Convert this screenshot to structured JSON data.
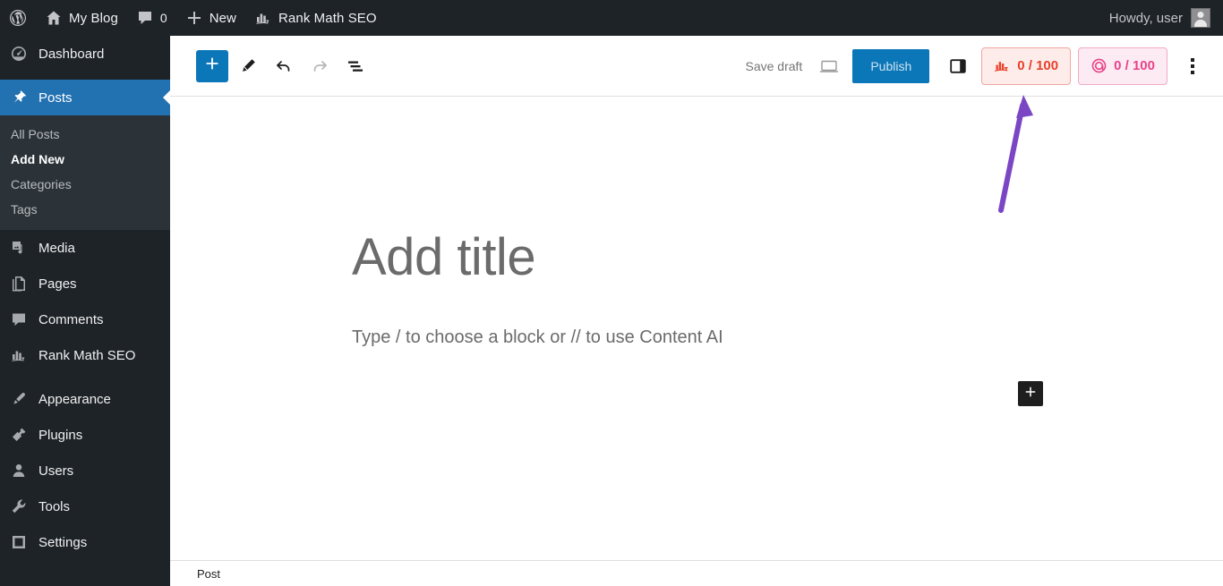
{
  "adminbar": {
    "logo_icon": "wordpress-icon",
    "site": {
      "icon": "home-icon",
      "label": "My Blog"
    },
    "comments": {
      "icon": "comment-icon",
      "count": "0"
    },
    "new": {
      "icon": "plus-icon",
      "label": "New"
    },
    "rankmath": {
      "icon": "rank-math-icon",
      "label": "Rank Math SEO"
    },
    "howdy": "Howdy, user",
    "avatar_icon": "avatar-icon"
  },
  "sidebar": {
    "items": [
      {
        "label": "Dashboard",
        "icon": "dashboard-icon",
        "active": false
      },
      {
        "label": "Posts",
        "icon": "pin-icon",
        "active": true
      },
      {
        "label": "Media",
        "icon": "media-icon",
        "active": false
      },
      {
        "label": "Pages",
        "icon": "pages-icon",
        "active": false
      },
      {
        "label": "Comments",
        "icon": "comment-icon",
        "active": false
      },
      {
        "label": "Rank Math SEO",
        "icon": "rank-math-icon",
        "active": false
      },
      {
        "label": "Appearance",
        "icon": "brush-icon",
        "active": false
      },
      {
        "label": "Plugins",
        "icon": "plug-icon",
        "active": false
      },
      {
        "label": "Users",
        "icon": "user-icon",
        "active": false
      },
      {
        "label": "Tools",
        "icon": "wrench-icon",
        "active": false
      },
      {
        "label": "Settings",
        "icon": "settings-icon",
        "active": false
      }
    ],
    "submenu": [
      {
        "label": "All Posts",
        "current": false
      },
      {
        "label": "Add New",
        "current": true
      },
      {
        "label": "Categories",
        "current": false
      },
      {
        "label": "Tags",
        "current": false
      }
    ]
  },
  "toolbar": {
    "add_block_icon": "plus-icon",
    "tools_icon": "pencil-icon",
    "undo_icon": "undo-icon",
    "redo_icon": "redo-icon",
    "outline_icon": "document-outline-icon",
    "save_draft_label": "Save draft",
    "preview_icon": "preview-laptop-icon",
    "publish_label": "Publish",
    "settings_sidebar_icon": "sidebar-toggle-icon",
    "options_icon": "kebab-menu-icon",
    "seo_score": {
      "icon": "rank-math-icon",
      "value": "0 / 100"
    },
    "content_ai_score": {
      "icon": "content-ai-icon",
      "value": "0 / 100"
    }
  },
  "canvas": {
    "title_placeholder": "Add title",
    "block_prompt": "Type / to choose a block or // to use Content AI",
    "inserter_icon": "plus-icon"
  },
  "footer": {
    "breadcrumb": "Post"
  },
  "annotation": {
    "arrow_color": "#7B46C4",
    "points_to": "seo-score-badge"
  },
  "colors": {
    "admin_dark": "#1d2327",
    "admin_submenu": "#2c3338",
    "active_blue": "#2271b1",
    "publish_blue": "#0b76b8",
    "seo_red": "#e8402a",
    "content_ai_pink": "#e8438a",
    "annotation_purple": "#7B46C4"
  }
}
